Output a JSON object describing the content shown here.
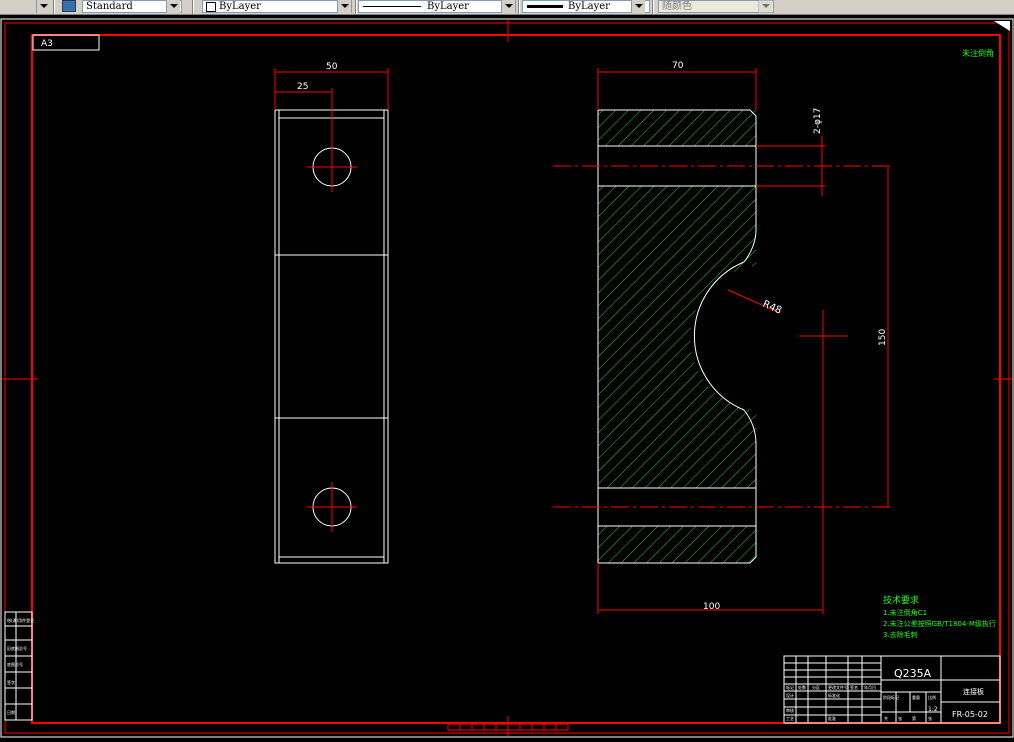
{
  "toolbar": {
    "text_style": "Standard",
    "layer": "ByLayer",
    "linetype": "ByLayer",
    "lineweight": "ByLayer",
    "color": "随颜色"
  },
  "sheet": {
    "size_label": "A3",
    "corner_note": "未注倒角"
  },
  "dimensions": {
    "front_width": "50",
    "front_hole_offset": "25",
    "section_width": "70",
    "hole_spec": "2-φ17",
    "radius": "R48",
    "height": "150",
    "base_length": "100"
  },
  "tech_requirements": {
    "title": "技术要求",
    "line1": "1.未注倒角C1",
    "line2": "2.未注公差按照GB/T1804-M级执行",
    "line3": "3.去除毛刺"
  },
  "title_block": {
    "material": "Q235A",
    "part_name": "连接板",
    "drawing_number": "FR-05-02",
    "scale": "1:2",
    "cells": [
      "标记",
      "处数",
      "分区",
      "更改文件号",
      "签名",
      "年月日",
      "设计",
      "标准化",
      "阶段标记",
      "重量",
      "比例",
      "审核",
      "工艺",
      "批准",
      "共",
      "张",
      "第",
      "张"
    ]
  },
  "side_stamps": [
    "借(通)用件登记",
    "旧底图总号",
    "底图总号",
    "签字",
    "日期"
  ]
}
